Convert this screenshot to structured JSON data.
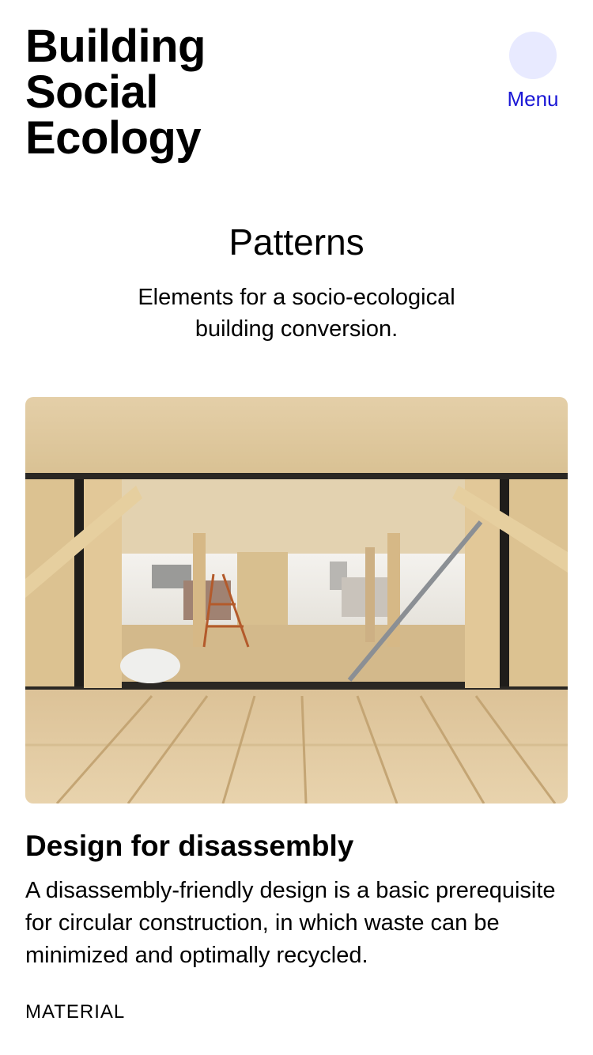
{
  "header": {
    "site_title_line1": "Building",
    "site_title_line2": "Social",
    "site_title_line3": "Ecology",
    "menu_label": "Menu",
    "menu_color": "#1a17d6",
    "menu_circle_color": "#e8eaff"
  },
  "section": {
    "title": "Patterns",
    "subtitle": "Elements for a socio-ecological building conversion."
  },
  "card": {
    "image_icon": "timber-construction-photo",
    "title": "Design for disassembly",
    "text": "A disassembly-friendly design is a basic prerequisite for circular construction, in which waste can be minimized and optimally recycled.",
    "tag": "MATERIAL"
  }
}
